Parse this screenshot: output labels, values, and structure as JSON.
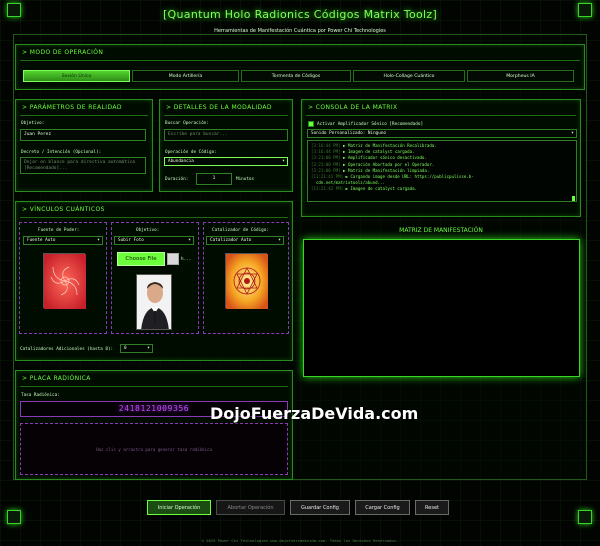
{
  "header": {
    "title": "[Quantum Holo Radionics Códigos Matrix Toolz]",
    "subtitle": "Herramientas de Manifestación Cuántica por Power Chi Technologies"
  },
  "mode": {
    "title": "MODO DE OPERACIÓN",
    "tabs": [
      "Sesión Única",
      "Modo Artillería",
      "Tormenta de Códigos",
      "Holo-Collage Cuántico",
      "Morpheus IA"
    ],
    "active_tab": 0
  },
  "reality": {
    "title": "PARÁMETROS DE REALIDAD",
    "objective_label": "Objetivo:",
    "objective_value": "Juan Perez",
    "decree_label": "Decreto / Intención (Opcional):",
    "decree_placeholder": "Dejar en blanco para directiva automática [Recomendado]..."
  },
  "modality": {
    "title": "DETALLES DE LA MODALIDAD",
    "search_label": "Buscar Operación:",
    "search_placeholder": "Escribe para buscar...",
    "code_label": "Operación de Código:",
    "code_value": "Abundancia",
    "duration_label": "Duración:",
    "duration_value": "1",
    "duration_unit": "Minutos"
  },
  "console": {
    "title": "CONSOLA DE LA MATRIX",
    "amplifier_label": "Activar Amplificador Sónico [Recomendado]",
    "sound_label": "Sonido Personalizado: Ninguno",
    "log": [
      {
        "ts": "[3:16:44 PM]",
        "msg": "Matriz de Manifestación Recalibrada."
      },
      {
        "ts": "[3:16:44 PM]",
        "msg": "Imagen de catalyst cargada."
      },
      {
        "ts": "[3:21:00 PM]",
        "msg": "Amplificador sónico desactivado."
      },
      {
        "ts": "[3:21:00 PM]",
        "msg": "Operación Abortada por el Operador."
      },
      {
        "ts": "[3:21:00 PM]",
        "msg": "Matriz de Manifestación limpiada."
      },
      {
        "ts": "[11:21:41 PM]",
        "msg": "Cargando image desde URL: https://publicpulisse.b-"
      },
      {
        "ts": "",
        "msg": "cdn.net/matrixtoolz/abund..."
      },
      {
        "ts": "[11:21:42 PM]",
        "msg": "Imagen de catalyst cargada."
      }
    ]
  },
  "links": {
    "title": "VÍNCULOS CUÁNTICOS",
    "columns": [
      {
        "label": "Fuente de Poder:",
        "select": "Fuente Auto"
      },
      {
        "label": "Objetivo:",
        "select": "Subir Foto",
        "button": "Choose File",
        "file": "h..."
      },
      {
        "label": "Catalizador de Código:",
        "select": "Catalizador Auto"
      }
    ],
    "extra_label": "Catalizadores Adicionales (hasta 8):",
    "extra_value": "0"
  },
  "matrix": {
    "title": "MATRIZ DE MANIFESTACIÓN"
  },
  "plate": {
    "title": "PLACA RADIÓNICA",
    "rate_label": "Tasa Radiónica:",
    "rate_value": "2418121009356",
    "area_hint": "Haz clic y arrastra para generar tasa radiónica"
  },
  "watermark": "DojoFuerzaDeVida.com",
  "actions": {
    "start": "Iniciar Operación",
    "abort": "Abortar Operación",
    "save": "Guardar Config",
    "load": "Cargar Config",
    "reset": "Reset"
  },
  "footer": "© 2025 Power Chi Technologies www.dojofuerzadevida.com. Todos los Derechos Reservados."
}
